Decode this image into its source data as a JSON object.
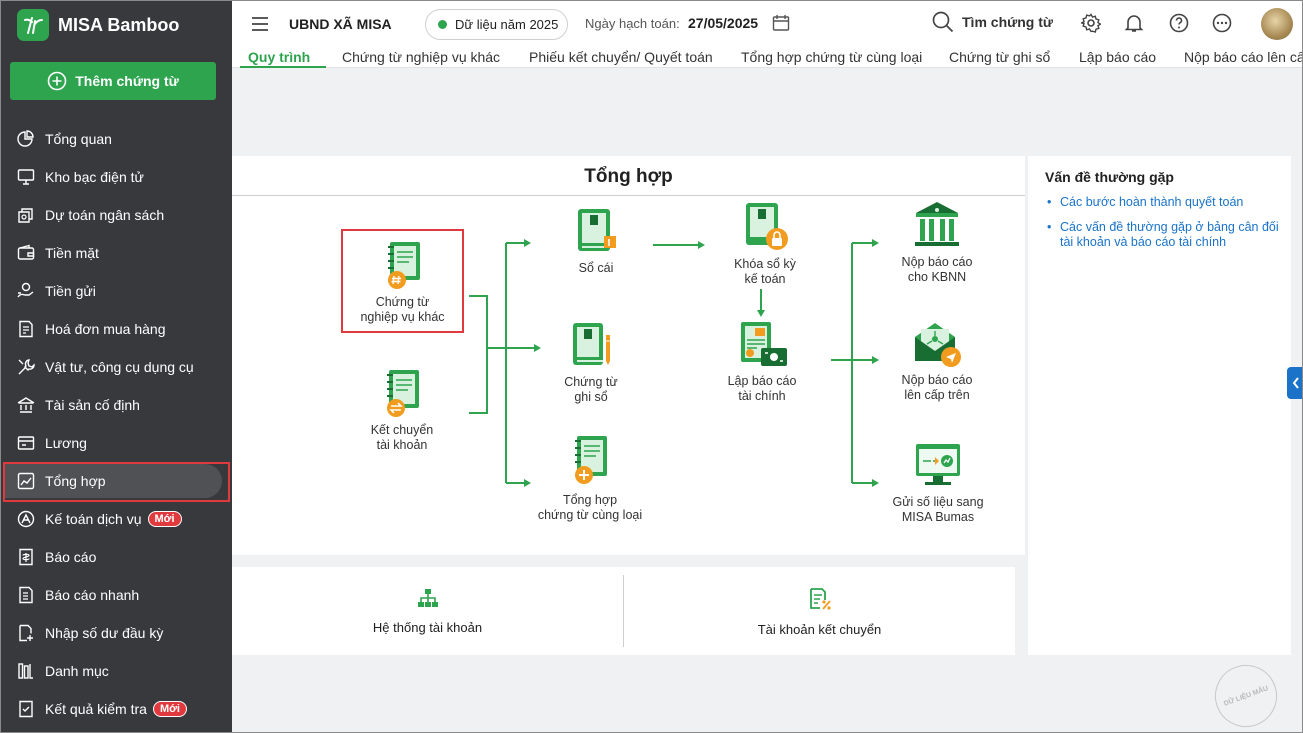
{
  "app": {
    "name": "MISA Bamboo",
    "add_button": "Thêm chứng từ"
  },
  "sidebar": {
    "items": [
      {
        "label": "Tổng quan",
        "icon": "pie-chart-icon"
      },
      {
        "label": "Kho bạc điện tử",
        "icon": "monitor-icon"
      },
      {
        "label": "Dự toán ngân sách",
        "icon": "budget-icon"
      },
      {
        "label": "Tiền mặt",
        "icon": "wallet-icon"
      },
      {
        "label": "Tiền gửi",
        "icon": "deposit-icon"
      },
      {
        "label": "Hoá đơn mua hàng",
        "icon": "invoice-icon"
      },
      {
        "label": "Vật tư, công cụ dụng cụ",
        "icon": "tools-icon"
      },
      {
        "label": "Tài sản cố định",
        "icon": "building-icon"
      },
      {
        "label": "Lương",
        "icon": "salary-icon"
      },
      {
        "label": "Tổng hợp",
        "icon": "summary-icon",
        "active": true
      },
      {
        "label": "Kế toán dịch vụ",
        "icon": "service-icon",
        "badge": "Mới"
      },
      {
        "label": "Báo cáo",
        "icon": "report-icon"
      },
      {
        "label": "Báo cáo nhanh",
        "icon": "quick-report-icon"
      },
      {
        "label": "Nhập số dư đầu kỳ",
        "icon": "opening-balance-icon"
      },
      {
        "label": "Danh mục",
        "icon": "catalog-icon"
      },
      {
        "label": "Kết quả kiểm tra",
        "icon": "check-result-icon",
        "badge": "Mới"
      }
    ]
  },
  "header": {
    "org": "UBND XÃ MISA",
    "year": "Dữ liệu năm 2025",
    "date_label": "Ngày hạch toán:",
    "date_value": "27/05/2025",
    "search": "Tìm chứng từ"
  },
  "tabs": [
    "Quy trình",
    "Chứng từ nghiệp vụ khác",
    "Phiếu kết chuyển/ Quyết toán",
    "Tổng hợp chứng từ cùng loại",
    "Chứng từ ghi sổ",
    "Lập báo cáo",
    "Nộp báo cáo lên cấp"
  ],
  "process": {
    "title": "Tổng hợp",
    "nodes": {
      "other": [
        "Chứng từ",
        "nghiệp vụ khác"
      ],
      "transfer": [
        "Kết chuyển",
        "tài khoản"
      ],
      "ledger": [
        "Sổ cái"
      ],
      "record": [
        "Chứng từ",
        "ghi sổ"
      ],
      "same": [
        "Tổng hợp",
        "chứng từ cùng loại"
      ],
      "lock": [
        "Khóa sổ kỳ",
        "kế toán"
      ],
      "fin": [
        "Lập báo cáo",
        "tài chính"
      ],
      "kbnn": [
        "Nộp báo cáo",
        "cho KBNN"
      ],
      "upper": [
        "Nộp báo cáo",
        "lên cấp trên"
      ],
      "bumas": [
        "Gửi số liệu sang",
        "MISA Bumas"
      ]
    }
  },
  "bottom": {
    "accounts": "Hệ thống tài khoản",
    "transfer_accounts": "Tài khoản kết chuyển"
  },
  "faq": {
    "title": "Vấn đề thường gặp",
    "items": [
      "Các bước hoàn thành quyết toán",
      "Các vấn đề thường gặp ở bảng cân đối tài khoản và báo cáo tài chính"
    ]
  },
  "watermark": "DỮ LIỆU MẪU",
  "colors": {
    "brand": "#2ea44f",
    "sidebar": "#38393d",
    "highlight": "#e03a3e",
    "link": "#1a73c8"
  }
}
